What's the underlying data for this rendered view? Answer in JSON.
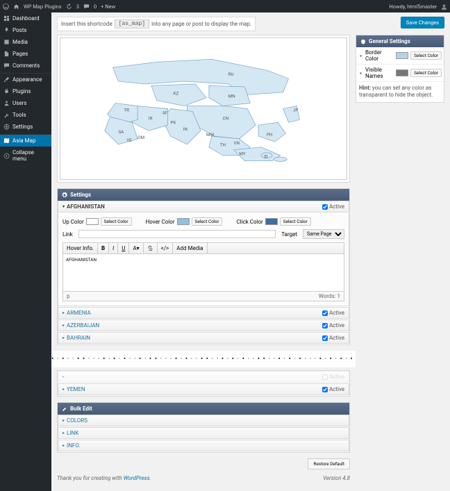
{
  "adminbar": {
    "site": "WP Map Plugins",
    "comments": "3",
    "updates": "0",
    "new": "New",
    "howdy": "Howdy, html5master"
  },
  "sidebar": {
    "items": [
      {
        "label": "Dashboard",
        "icon": "dashboard"
      },
      {
        "label": "Posts",
        "icon": "pin"
      },
      {
        "label": "Media",
        "icon": "media"
      },
      {
        "label": "Pages",
        "icon": "page"
      },
      {
        "label": "Comments",
        "icon": "comment"
      },
      {
        "label": "Appearance",
        "icon": "brush"
      },
      {
        "label": "Plugins",
        "icon": "plug"
      },
      {
        "label": "Users",
        "icon": "users"
      },
      {
        "label": "Tools",
        "icon": "wrench"
      },
      {
        "label": "Settings",
        "icon": "gear"
      },
      {
        "label": "Asia Map",
        "icon": "map",
        "current": true
      },
      {
        "label": "Collapse menu",
        "icon": "collapse"
      }
    ]
  },
  "shortcode": {
    "prefix": "Insert this shortcode",
    "code": "[as_map]",
    "suffix": "into any page or post to display the map."
  },
  "save_btn": "Save Changes",
  "general": {
    "title": "General Settings",
    "rows": [
      {
        "label": "Border Color",
        "color": "#b4d3e6",
        "btn": "Select Color"
      },
      {
        "label": "Visible Names",
        "color": "#777777",
        "btn": "Select Color"
      }
    ],
    "hint_b": "Hint:",
    "hint": "you can set any color as transparent to hide the object."
  },
  "settings": {
    "title": "Settings"
  },
  "afghan": {
    "name": "AFGHANISTAN",
    "active": "Active",
    "up": {
      "label": "Up Color",
      "color": "#ffffff",
      "btn": "Select Color"
    },
    "hover": {
      "label": "Hover Color",
      "color": "#8fc1e0",
      "btn": "Select Color"
    },
    "click": {
      "label": "Click Color",
      "color": "#3b6ea5",
      "btn": "Select Color"
    },
    "link_label": "Link",
    "target_label": "Target",
    "target_value": "Same Page",
    "editor": {
      "tabs": [
        "Hover Info."
      ],
      "buttons": [
        "B",
        "I",
        "U",
        "A",
        "link",
        "code",
        "Add Media"
      ],
      "text": "AFGHANISTAN",
      "path": "p",
      "words_label": "Words:",
      "words": "1"
    }
  },
  "countries": [
    {
      "name": "ARMENIA",
      "active": true
    },
    {
      "name": "AZERBAIJAN",
      "active": true
    },
    {
      "name": "BAHRAIN",
      "active": true
    }
  ],
  "yemen": {
    "name": "YEMEN",
    "active": true,
    "label": "Active"
  },
  "bulk": {
    "title": "Bulk Edit",
    "items": [
      "COLORS",
      "LINK",
      "INFO."
    ]
  },
  "restore": "Restore Default",
  "footer": {
    "text": "Thank you for creating with ",
    "link": "WordPress",
    "version": "Version 4.8"
  },
  "map_labels": [
    "RU",
    "KZ",
    "MN",
    "CN",
    "JP",
    "IN",
    "TR",
    "IR",
    "SA",
    "AF",
    "PK",
    "MM",
    "TH",
    "VN",
    "PH",
    "ID",
    "MY",
    "YE",
    "OM"
  ]
}
